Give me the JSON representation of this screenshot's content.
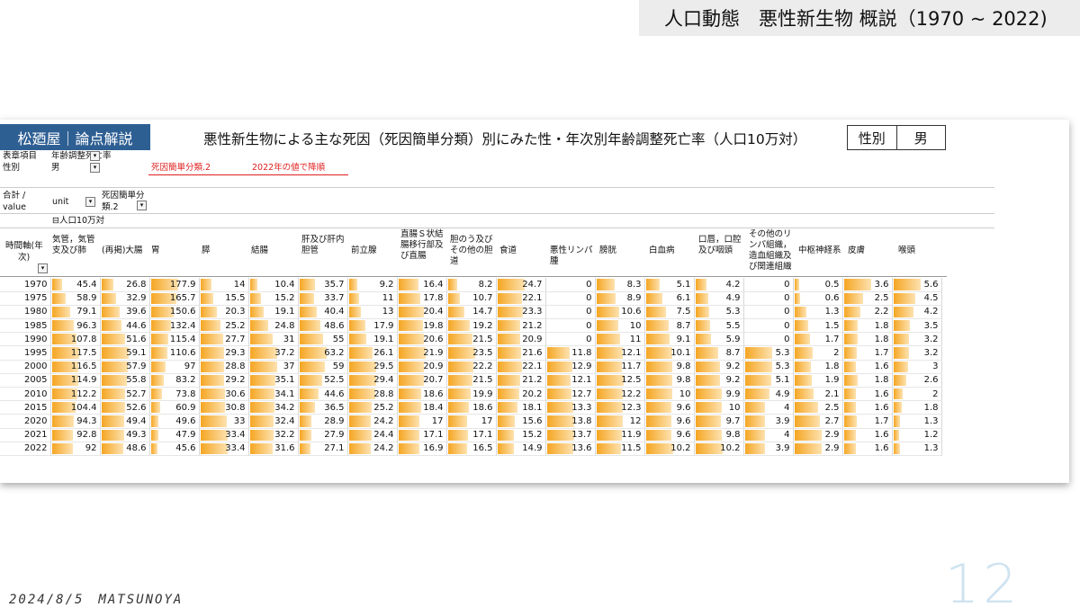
{
  "slide_title": "人口動態　悪性新生物 概説（1970 ~ 2022)",
  "brand": "松廼屋｜論点解説",
  "table_title": "悪性新生物による主な死因（死因簡単分類）別にみた性・年次別年齢調整死亡率（人口10万対）",
  "gender": {
    "label": "性別",
    "value": "男"
  },
  "filters": {
    "item_label": "表章項目",
    "item_value": "年齢調整死亡率",
    "sex_label": "性別",
    "sex_value": "男",
    "note1": "死因簡単分類.2",
    "note2": "2022年の値で降順"
  },
  "meta": {
    "total": "合計 /",
    "value": "value",
    "unit": "unit",
    "cause_field": "死因簡単分",
    "cause_field2": "類.2",
    "unit_value": "⊟人口10万対",
    "time_axis": "時間軸(年",
    "time_axis2": "次)"
  },
  "columns": [
    "気管，気管支及び肺",
    "(再掲)大腸",
    "胃",
    "膵",
    "結腸",
    "肝及び肝内胆管",
    "前立腺",
    "直腸Ｓ状結腸移行部及び直腸",
    "胆のう及びその他の胆道",
    "食道",
    "悪性リンパ腫",
    "膀胱",
    "白血病",
    "口唇，口腔及び咽頭",
    "その他のリンパ組織，造血組織及び関連組織",
    "中枢神経系",
    "皮膚",
    "喉頭"
  ],
  "rows": [
    {
      "year": "1970",
      "values": [
        "45.4",
        "26.8",
        "177.9",
        "14",
        "10.4",
        "35.7",
        "9.2",
        "16.4",
        "8.2",
        "24.7",
        "0",
        "8.3",
        "5.1",
        "4.2",
        "0",
        "0.5",
        "3.6",
        "5.6"
      ]
    },
    {
      "year": "1975",
      "values": [
        "58.9",
        "32.9",
        "165.7",
        "15.5",
        "15.2",
        "33.7",
        "11",
        "17.8",
        "10.7",
        "22.1",
        "0",
        "8.9",
        "6.1",
        "4.9",
        "0",
        "0.6",
        "2.5",
        "4.5"
      ]
    },
    {
      "year": "1980",
      "values": [
        "79.1",
        "39.6",
        "150.6",
        "20.3",
        "19.1",
        "40.4",
        "13",
        "20.4",
        "14.7",
        "23.3",
        "0",
        "10.6",
        "7.5",
        "5.3",
        "0",
        "1.3",
        "2.2",
        "4.2"
      ]
    },
    {
      "year": "1985",
      "values": [
        "96.3",
        "44.6",
        "132.4",
        "25.2",
        "24.8",
        "48.6",
        "17.9",
        "19.8",
        "19.2",
        "21.2",
        "0",
        "10",
        "8.7",
        "5.5",
        "0",
        "1.5",
        "1.8",
        "3.5"
      ]
    },
    {
      "year": "1990",
      "values": [
        "107.8",
        "51.6",
        "115.4",
        "27.7",
        "31",
        "55",
        "19.1",
        "20.6",
        "21.5",
        "20.9",
        "0",
        "11",
        "9.1",
        "5.9",
        "0",
        "1.7",
        "1.8",
        "3.2"
      ]
    },
    {
      "year": "1995",
      "values": [
        "117.5",
        "59.1",
        "110.6",
        "29.3",
        "37.2",
        "63.2",
        "26.1",
        "21.9",
        "23.5",
        "21.6",
        "11.8",
        "12.1",
        "10.1",
        "8.7",
        "5.3",
        "2",
        "1.7",
        "3.2"
      ]
    },
    {
      "year": "2000",
      "values": [
        "116.5",
        "57.9",
        "97",
        "28.8",
        "37",
        "59",
        "29.5",
        "20.9",
        "22.2",
        "22.1",
        "12.9",
        "11.7",
        "9.8",
        "9.2",
        "5.3",
        "1.8",
        "1.6",
        "3"
      ]
    },
    {
      "year": "2005",
      "values": [
        "114.9",
        "55.8",
        "83.2",
        "29.2",
        "35.1",
        "52.5",
        "29.4",
        "20.7",
        "21.5",
        "21.2",
        "12.1",
        "12.5",
        "9.8",
        "9.2",
        "5.1",
        "1.9",
        "1.8",
        "2.6"
      ]
    },
    {
      "year": "2010",
      "values": [
        "112.2",
        "52.7",
        "73.8",
        "30.6",
        "34.1",
        "44.6",
        "28.8",
        "18.6",
        "19.9",
        "20.2",
        "12.7",
        "12.2",
        "10",
        "9.9",
        "4.9",
        "2.1",
        "1.6",
        "2"
      ]
    },
    {
      "year": "2015",
      "values": [
        "104.4",
        "52.6",
        "60.9",
        "30.8",
        "34.2",
        "36.5",
        "25.2",
        "18.4",
        "18.6",
        "18.1",
        "13.3",
        "12.3",
        "9.6",
        "10",
        "4",
        "2.5",
        "1.6",
        "1.8"
      ]
    },
    {
      "year": "2020",
      "values": [
        "94.3",
        "49.4",
        "49.6",
        "33",
        "32.4",
        "28.9",
        "24.2",
        "17",
        "17",
        "15.6",
        "13.8",
        "12",
        "9.6",
        "9.7",
        "3.9",
        "2.7",
        "1.7",
        "1.3"
      ]
    },
    {
      "year": "2021",
      "values": [
        "92.8",
        "49.3",
        "47.9",
        "33.4",
        "32.2",
        "27.9",
        "24.4",
        "17.1",
        "17.1",
        "15.2",
        "13.7",
        "11.9",
        "9.6",
        "9.8",
        "4",
        "2.9",
        "1.6",
        "1.2"
      ]
    },
    {
      "year": "2022",
      "values": [
        "92",
        "48.6",
        "45.6",
        "33.4",
        "31.6",
        "27.1",
        "24.2",
        "16.9",
        "16.5",
        "14.9",
        "13.6",
        "11.5",
        "10.2",
        "10.2",
        "3.9",
        "2.9",
        "1.6",
        "1.3"
      ]
    }
  ],
  "bar_color": "#f5a623",
  "footer": "2024/8/5　MATSUNOYA",
  "page_number": "12"
}
